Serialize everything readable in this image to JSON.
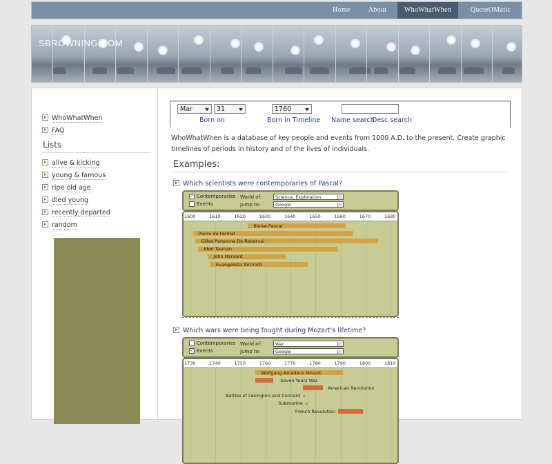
{
  "nav": {
    "items": [
      {
        "label": "Home",
        "active": false
      },
      {
        "label": "About",
        "active": false
      },
      {
        "label": "WhoWhatWhen",
        "active": true
      },
      {
        "label": "QuoteOMatic",
        "active": false
      }
    ]
  },
  "banner": {
    "site_title": "SBROWNING.COM"
  },
  "sidebar": {
    "top_links": [
      "WhoWhatWhen",
      "FAQ"
    ],
    "lists_heading": "Lists",
    "list_links": [
      "alive & kicking",
      "young & famous",
      "ripe old age",
      "died young",
      "recently departed",
      "random"
    ]
  },
  "search": {
    "month": "Mar",
    "day": "31",
    "year": "1760",
    "name_value": "",
    "born_on_label": "Born on",
    "born_in_timeline_label": "Born in Timeline",
    "name_search_label": "Name search",
    "desc_search_label": "Desc search"
  },
  "description": "WhoWhatWhen is a database of key people and events from 1000 A.D. to the present. Create graphic timelines of periods in history and of the lives of individuals.",
  "examples": {
    "heading": "Examples:",
    "items": [
      {
        "question": "Which scientists were contemporaries of Pascal?",
        "contemporaries_label": "Contemporaries",
        "contemporaries_checked": true,
        "events_label": "Events",
        "events_checked": false,
        "world_of_label": "World of:",
        "world_of_value": "Science, Exploration",
        "jump_to_label": "Jump to:",
        "jump_to_value": "Google",
        "ticks": [
          "1600",
          "1610",
          "1620",
          "1630",
          "1640",
          "1650",
          "1660",
          "1670",
          "1680"
        ],
        "people": [
          {
            "name": "Blaise  Pascal",
            "start": 1623,
            "end": 1662
          },
          {
            "name": "Pierre  de Fermat",
            "start": 1601,
            "end": 1665
          },
          {
            "name": "Gilles Personne De Roberval",
            "start": 1602,
            "end": 1675
          },
          {
            "name": "Abel  Tasman",
            "start": 1603,
            "end": 1659
          },
          {
            "name": "John  Harvard",
            "start": 1607,
            "end": 1638
          },
          {
            "name": "Evangelista  Torricelli",
            "start": 1608,
            "end": 1647
          }
        ]
      },
      {
        "question": "Which wars were being fought during Mozart's lifetime?",
        "contemporaries_label": "Contemporaries",
        "contemporaries_checked": false,
        "events_label": "Events",
        "events_checked": true,
        "world_of_label": "World of:",
        "world_of_value": "War",
        "jump_to_label": "Jump to:",
        "jump_to_value": "Google",
        "ticks": [
          "1730",
          "1740",
          "1750",
          "1760",
          "1770",
          "1780",
          "1790",
          "1800",
          "1810"
        ],
        "people": [
          {
            "name": "Wolfgang Amadeus  Mozart",
            "start": 1756,
            "end": 1791
          }
        ],
        "events": [
          {
            "name": "Seven Years War",
            "start": 1756,
            "end": 1763
          },
          {
            "name": "American Revolution",
            "start": 1775,
            "end": 1783
          },
          {
            "name": "Battles of Lexington and Concord",
            "start": 1775,
            "end": 1775
          },
          {
            "name": "Submarine",
            "start": 1776,
            "end": 1776
          },
          {
            "name": "French Revolution",
            "start": 1789,
            "end": 1799
          }
        ]
      }
    ]
  },
  "colors": {
    "olive_panel": "#8c8a54",
    "timeline_bg": "#c7cb94",
    "person_bar": "#d6a240",
    "event_bar": "#d46a3a",
    "nav_bg": "#7a8ea5",
    "nav_active": "#4a5b6d"
  }
}
